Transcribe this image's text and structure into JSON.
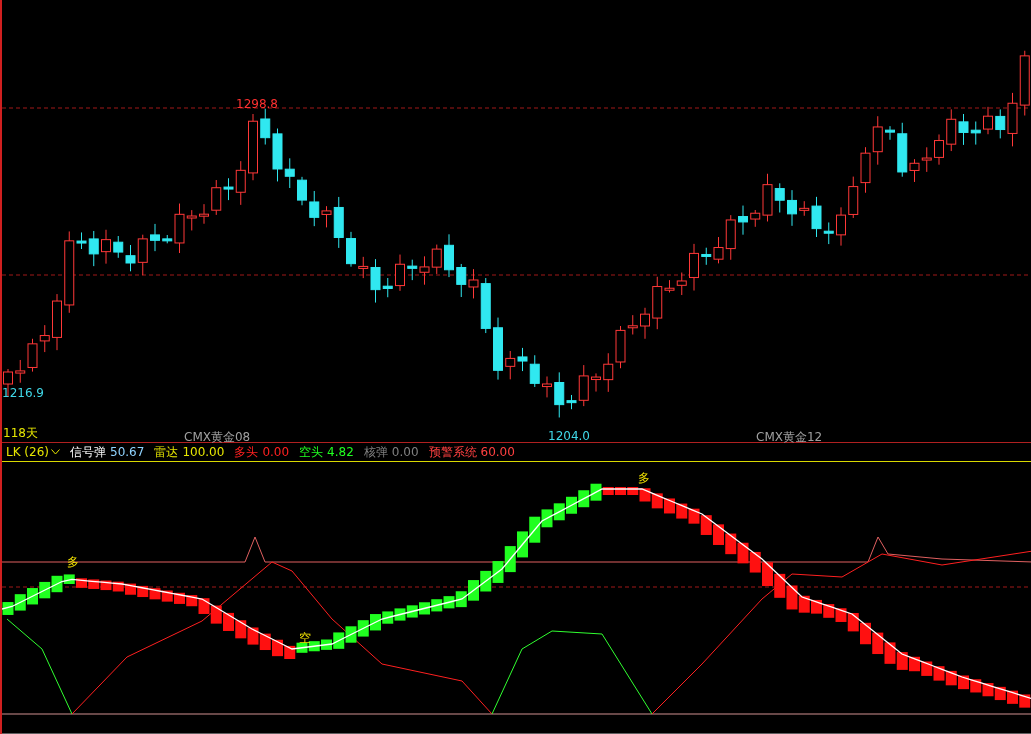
{
  "price_chart": {
    "labels": [
      {
        "kind": "high",
        "text": "1298.8"
      },
      {
        "kind": "low",
        "text": "1216.9"
      },
      {
        "kind": "period",
        "text": "118天"
      },
      {
        "kind": "contract",
        "text": "CMX黄金08"
      },
      {
        "kind": "low",
        "text": "1204.0"
      },
      {
        "kind": "contract",
        "text": "CMX黄金12"
      }
    ]
  },
  "indicator": {
    "name": "LK (26)",
    "items": [
      {
        "kind": "signal",
        "name": "信号弹",
        "value": "50.67",
        "color": "#8fd3ff"
      },
      {
        "kind": "line",
        "name": "雷达",
        "value": "100.00",
        "color": "#e6e600"
      },
      {
        "kind": "line",
        "name": "多头",
        "value": "0.00",
        "color": "#ff2020"
      },
      {
        "kind": "line",
        "name": "空头",
        "value": "4.82",
        "color": "#20ff20"
      },
      {
        "kind": "line",
        "name": "核弹",
        "value": "0.00",
        "color": "#808080"
      },
      {
        "kind": "line",
        "name": "预警系统",
        "value": "60.00",
        "color": "#ff4040"
      }
    ],
    "markers": [
      {
        "text": "多"
      },
      {
        "text": "空"
      },
      {
        "text": "多"
      }
    ]
  }
}
